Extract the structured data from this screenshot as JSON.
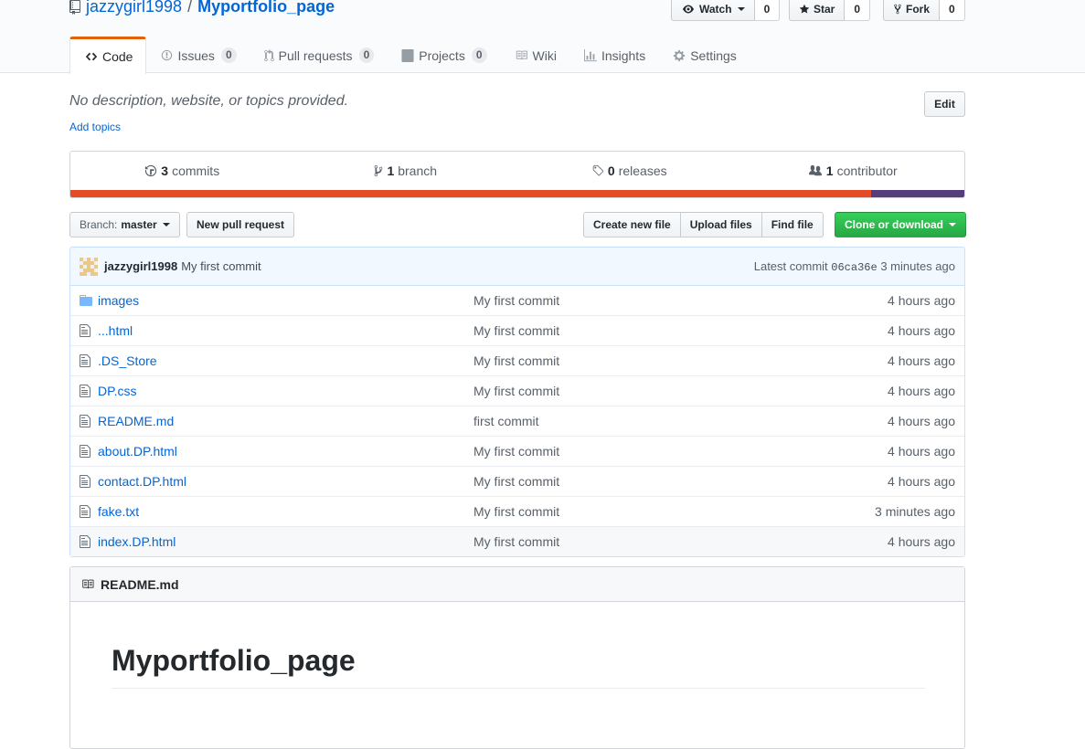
{
  "repo": {
    "owner": "jazzygirl1998",
    "separator": "/",
    "name": "Myportfolio_page"
  },
  "actions": {
    "watch": {
      "label": "Watch",
      "count": "0"
    },
    "star": {
      "label": "Star",
      "count": "0"
    },
    "fork": {
      "label": "Fork",
      "count": "0"
    }
  },
  "tabs": [
    {
      "label": "Code",
      "icon": "code-icon"
    },
    {
      "label": "Issues",
      "count": "0",
      "icon": "issue-icon"
    },
    {
      "label": "Pull requests",
      "count": "0",
      "icon": "pull-request-icon"
    },
    {
      "label": "Projects",
      "count": "0",
      "icon": "project-icon"
    },
    {
      "label": "Wiki",
      "icon": "book-icon"
    },
    {
      "label": "Insights",
      "icon": "graph-icon"
    },
    {
      "label": "Settings",
      "icon": "gear-icon"
    }
  ],
  "description": "No description, website, or topics provided.",
  "add_topics": "Add topics",
  "edit_label": "Edit",
  "summary": {
    "commits": {
      "num": "3",
      "label": "commits"
    },
    "branch": {
      "num": "1",
      "label": "branch"
    },
    "releases": {
      "num": "0",
      "label": "releases"
    },
    "contributor": {
      "num": "1",
      "label": "contributor"
    }
  },
  "language_colors": [
    "#e34c26",
    "#563d7c"
  ],
  "language_shares": [
    0.896,
    0.104
  ],
  "file_nav": {
    "branch_label": "Branch:",
    "branch_name": "master",
    "new_pr": "New pull request",
    "create_file": "Create new file",
    "upload": "Upload files",
    "find": "Find file",
    "clone": "Clone or download"
  },
  "commit_tease": {
    "author": "jazzygirl1998",
    "message": "My first commit",
    "latest_label": "Latest commit",
    "sha": "06ca36e",
    "age": "3 minutes ago"
  },
  "files": [
    {
      "name": "images",
      "message": "My first commit",
      "age": "4 hours ago",
      "type": "dir"
    },
    {
      "name": "...html",
      "message": "My first commit",
      "age": "4 hours ago",
      "type": "file"
    },
    {
      "name": ".DS_Store",
      "message": "My first commit",
      "age": "4 hours ago",
      "type": "file"
    },
    {
      "name": "DP.css",
      "message": "My first commit",
      "age": "4 hours ago",
      "type": "file"
    },
    {
      "name": "README.md",
      "message": "first commit",
      "age": "4 hours ago",
      "type": "file"
    },
    {
      "name": "about.DP.html",
      "message": "My first commit",
      "age": "4 hours ago",
      "type": "file"
    },
    {
      "name": "contact.DP.html",
      "message": "My first commit",
      "age": "4 hours ago",
      "type": "file"
    },
    {
      "name": "fake.txt",
      "message": "My first commit",
      "age": "3 minutes ago",
      "type": "file"
    },
    {
      "name": "index.DP.html",
      "message": "My first commit",
      "age": "4 hours ago",
      "type": "file"
    }
  ],
  "readme": {
    "filename": "README.md",
    "heading": "Myportfolio_page"
  }
}
